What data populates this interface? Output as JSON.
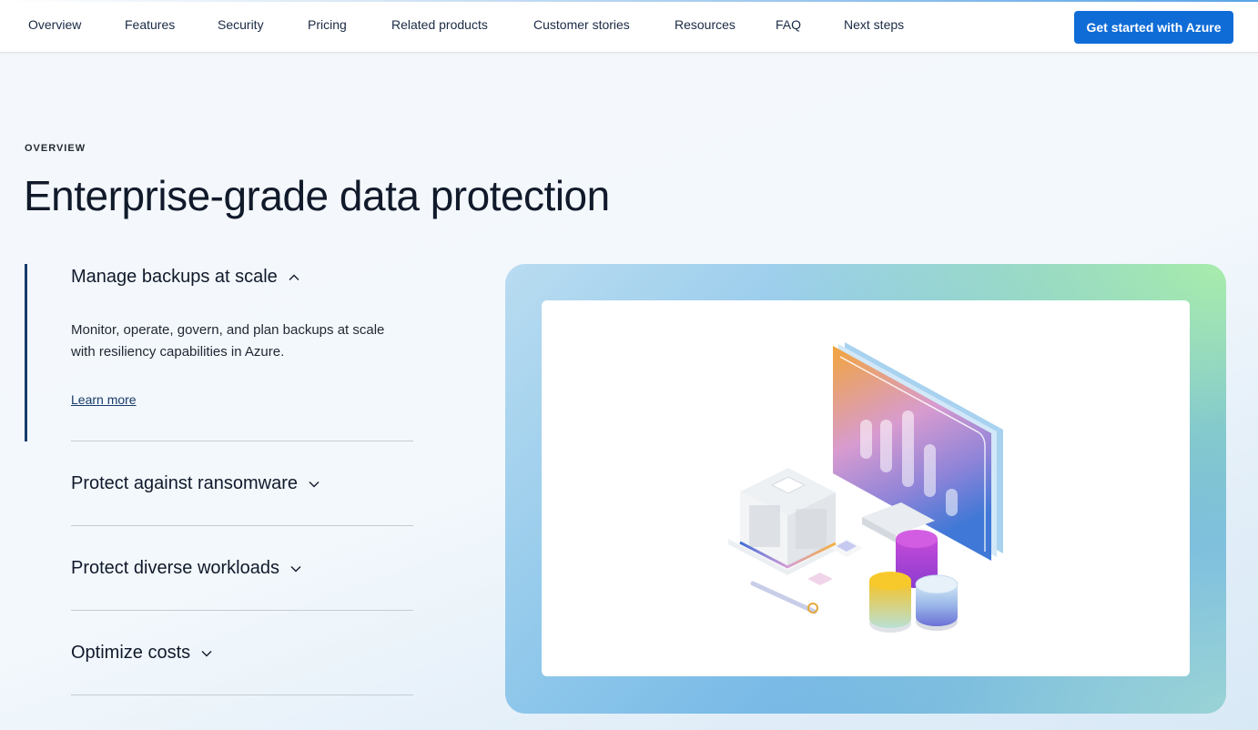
{
  "nav": {
    "items": [
      "Overview",
      "Features",
      "Security",
      "Pricing",
      "Related products",
      "Customer stories",
      "Resources",
      "FAQ",
      "Next steps"
    ],
    "cta_label": "Get started with Azure"
  },
  "hero": {
    "eyebrow": "OVERVIEW",
    "title": "Enterprise-grade data protection"
  },
  "accordion": {
    "items": [
      {
        "label": "Manage backups at scale",
        "expanded": true,
        "description": "Monitor, operate, govern, and plan backups at scale with resiliency capabilities in Azure.",
        "link_label": "Learn more"
      },
      {
        "label": "Protect against ransomware",
        "expanded": false
      },
      {
        "label": "Protect diverse workloads",
        "expanded": false
      },
      {
        "label": "Optimize costs",
        "expanded": false
      }
    ]
  },
  "colors": {
    "accent": "#0f6cd7",
    "active_indicator": "#163b6b",
    "text": "#111a2b"
  },
  "icons": [
    "chevron-up-icon",
    "chevron-down-icon",
    "monitor-icon",
    "server-icon",
    "database-icon"
  ]
}
